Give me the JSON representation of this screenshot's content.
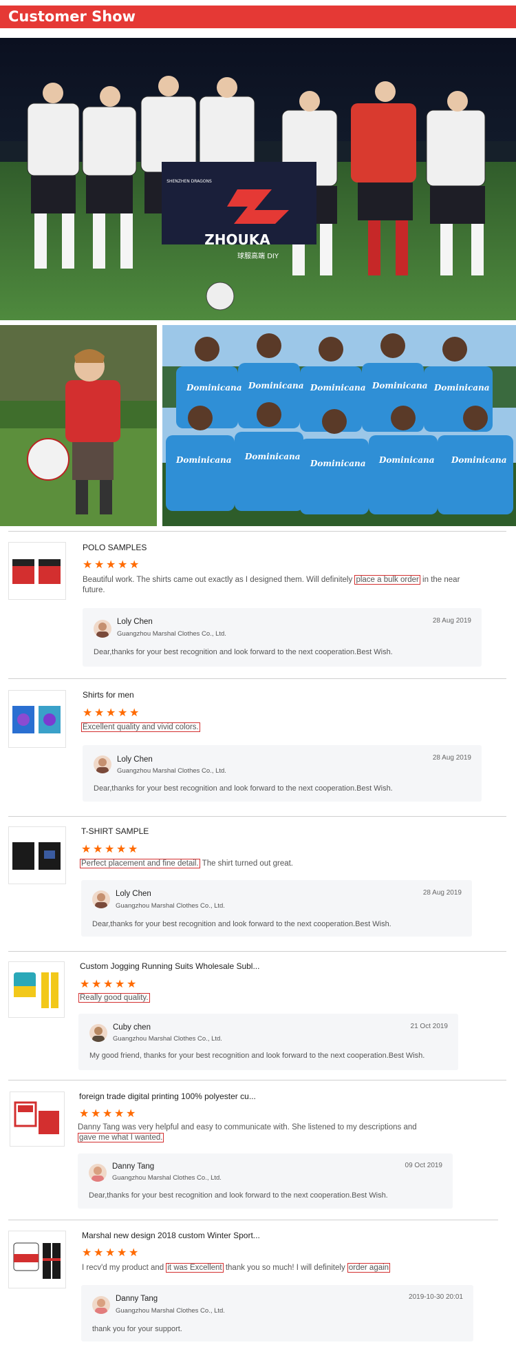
{
  "banner": {
    "title": "Customer Show"
  },
  "photos": {
    "team1_flag_brand": "ZHOUKA",
    "team1_flag_sub": "球服高端 DIY",
    "team1_flag_badge": "SHENZHEN DRAGONS",
    "team2_jersey_text": "Dominicana"
  },
  "reviews": [
    {
      "title": "POLO SAMPLES",
      "stars": 5,
      "text_parts": [
        "Beautiful work.  The shirts came out exactly as I designed them.  Will definitely ",
        "place a bulk order",
        " in the near future."
      ],
      "reply": {
        "name": "Loly Chen",
        "company": "Guangzhou Marshal Clothes Co., Ltd.",
        "date": "28 Aug 2019",
        "text": "Dear,thanks for your best recognition and look forward to the next cooperation.Best Wish."
      }
    },
    {
      "title": "Shirts for men",
      "stars": 5,
      "text_parts": [
        "",
        "Excellent quality and vivid colors.",
        ""
      ],
      "reply": {
        "name": "Loly Chen",
        "company": "Guangzhou Marshal Clothes Co., Ltd.",
        "date": "28 Aug 2019",
        "text": "Dear,thanks for your best recognition and look forward to the next cooperation.Best Wish."
      }
    },
    {
      "title": "T-SHIRT SAMPLE",
      "stars": 5,
      "text_parts": [
        "",
        "Perfect placement and fine detail.",
        " The shirt turned out great."
      ],
      "reply": {
        "name": "Loly Chen",
        "company": "Guangzhou Marshal Clothes Co., Ltd.",
        "date": "28 Aug 2019",
        "text": "Dear,thanks for your best recognition and look forward to the next cooperation.Best Wish."
      }
    },
    {
      "title": "Custom Jogging Running Suits Wholesale Subl...",
      "stars": 5,
      "text_parts": [
        "",
        "Really good quality.",
        ""
      ],
      "reply": {
        "name": "Cuby chen",
        "company": "Guangzhou Marshal Clothes Co., Ltd.",
        "date": "21 Oct 2019",
        "text": "My good friend, thanks for your best recognition and look forward to the next cooperation.Best Wish."
      }
    },
    {
      "title": "foreign trade digital printing 100% polyester cu...",
      "stars": 5,
      "text_parts": [
        "Danny Tang was very helpful and easy to communicate with. She listened to my descriptions and ",
        "gave me what I wanted.",
        ""
      ],
      "reply": {
        "name": "Danny Tang",
        "company": "Guangzhou Marshal Clothes Co., Ltd.",
        "date": "09 Oct 2019",
        "text": "Dear,thanks for your best recognition and look forward to the next cooperation.Best Wish."
      }
    },
    {
      "title": "Marshal new design 2018 custom Winter Sport...",
      "stars": 5,
      "text_parts": [
        "I recv'd my product and ",
        "it was Excellent",
        " thank you so much! I will definitely ",
        "order again",
        ""
      ],
      "reply": {
        "name": "Danny Tang",
        "company": "Guangzhou Marshal Clothes Co., Ltd.",
        "date": "2019-10-30 20:01",
        "text": "thank you for your support."
      }
    }
  ],
  "colors": {
    "banner": "#e53935",
    "star": "#ff6a00",
    "highlight": "#d32f2f"
  }
}
